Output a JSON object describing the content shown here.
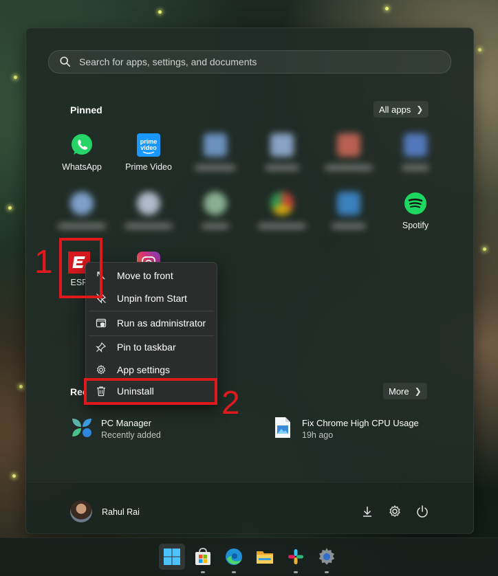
{
  "search": {
    "placeholder": "Search for apps, settings, and documents"
  },
  "pinned": {
    "title": "Pinned",
    "all_apps_label": "All apps",
    "apps": [
      {
        "label": "WhatsApp"
      },
      {
        "label": "Prime Video"
      },
      {
        "label": "Spotify"
      },
      {
        "label": "ESP"
      }
    ]
  },
  "context_menu": {
    "items": [
      {
        "label": "Move to front"
      },
      {
        "label": "Unpin from Start"
      },
      {
        "label": "Run as administrator"
      },
      {
        "label": "Pin to taskbar"
      },
      {
        "label": "App settings"
      },
      {
        "label": "Uninstall"
      }
    ]
  },
  "recommended": {
    "title_partial": "Rec",
    "more_label": "More",
    "items": [
      {
        "title": "PC Manager",
        "subtitle": "Recently added"
      },
      {
        "title": "Fix Chrome High CPU Usage",
        "subtitle": "19h ago"
      }
    ]
  },
  "user": {
    "name": "Rahul Rai"
  },
  "annotations": {
    "step1": "1",
    "step2": "2"
  },
  "icon_names": [
    "search-icon",
    "whatsapp-icon",
    "prime-video-icon",
    "spotify-icon",
    "espn-icon",
    "instagram-icon",
    "download-icon",
    "gear-icon",
    "power-icon",
    "windows-icon",
    "store-icon",
    "edge-icon",
    "folder-icon",
    "slack-icon",
    "settings-icon"
  ],
  "colors": {
    "annotation_red": "#e0191d",
    "spotify_green": "#1ed760",
    "whatsapp_green": "#25d366",
    "prime_blue": "#1a98ff"
  }
}
